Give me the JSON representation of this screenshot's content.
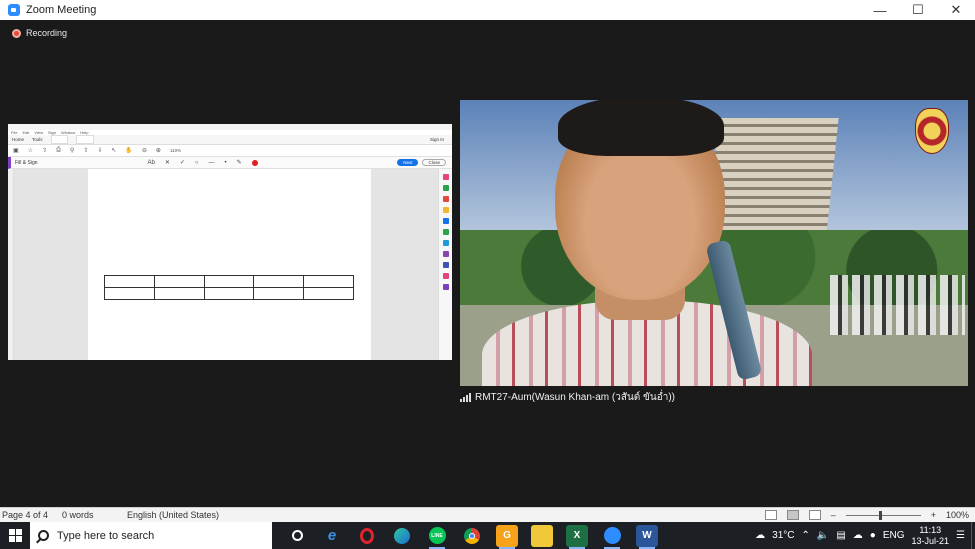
{
  "window": {
    "title": "Zoom Meeting",
    "minimize_icon": "minimize-icon",
    "maximize_icon": "maximize-icon",
    "close_icon": "close-icon"
  },
  "recording": {
    "label": "Recording"
  },
  "shared_doc": {
    "menu": [
      "File",
      "Edit",
      "View",
      "Sign",
      "Window",
      "Help"
    ],
    "tabs": [
      "Home",
      "Tools"
    ],
    "sign_in": "Sign In",
    "zoom_level": "110%",
    "fill_sign": "Fill & Sign",
    "next_label": "Next",
    "close_label": "Close"
  },
  "participant": {
    "name": "RMT27-Aum(Wasun Khan-am (วสันต์ ขันอ่ำ))"
  },
  "word_status": {
    "page": "Page 4 of 4",
    "words": "0 words",
    "language": "English (United States)",
    "zoom": "100%"
  },
  "taskbar": {
    "search_placeholder": "Type here to search",
    "temperature": "31°C",
    "language": "ENG",
    "time": "11:13",
    "date": "13-Jul-21"
  }
}
